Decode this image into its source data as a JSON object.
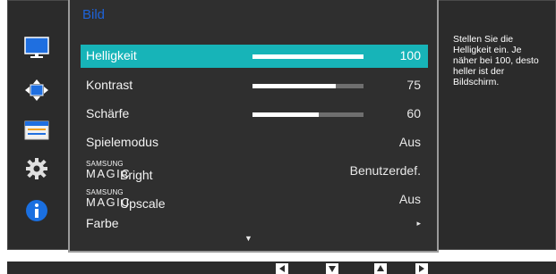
{
  "menu": {
    "title": "Bild",
    "rows": [
      {
        "label": "Helligkeit",
        "value": "100",
        "bar": 1.0,
        "selected": true
      },
      {
        "label": "Kontrast",
        "value": "75",
        "bar": 0.75
      },
      {
        "label": "Schärfe",
        "value": "60",
        "bar": 0.6
      },
      {
        "label": "Spielemodus",
        "value": "Aus"
      },
      {
        "brand_top": "SAMSUNG",
        "brand_bottom": "MAGIC",
        "label": "Bright",
        "value": "Benutzerdef."
      },
      {
        "brand_top": "SAMSUNG",
        "brand_bottom": "MAGIC",
        "label": "Upscale",
        "value": "Aus"
      },
      {
        "label": "Farbe",
        "value": "▸"
      }
    ],
    "more_arrow": "▼"
  },
  "sidebar": {
    "icons": [
      "monitor-icon",
      "move-arrows-icon",
      "settings-panel-icon",
      "gear-icon",
      "info-icon"
    ]
  },
  "description": "Stellen Sie die Helligkeit ein. Je näher bei 100, desto heller ist der Bildschirm.",
  "navigation": {
    "buttons": [
      "left-arrow-icon",
      "down-arrow-icon",
      "up-arrow-icon",
      "right-arrow-icon"
    ]
  },
  "colors": {
    "osd_background": "#2b2b2b",
    "selected_row": "#17b4b8",
    "title": "#1e63d8",
    "info_blue": "#1a6fe0"
  }
}
